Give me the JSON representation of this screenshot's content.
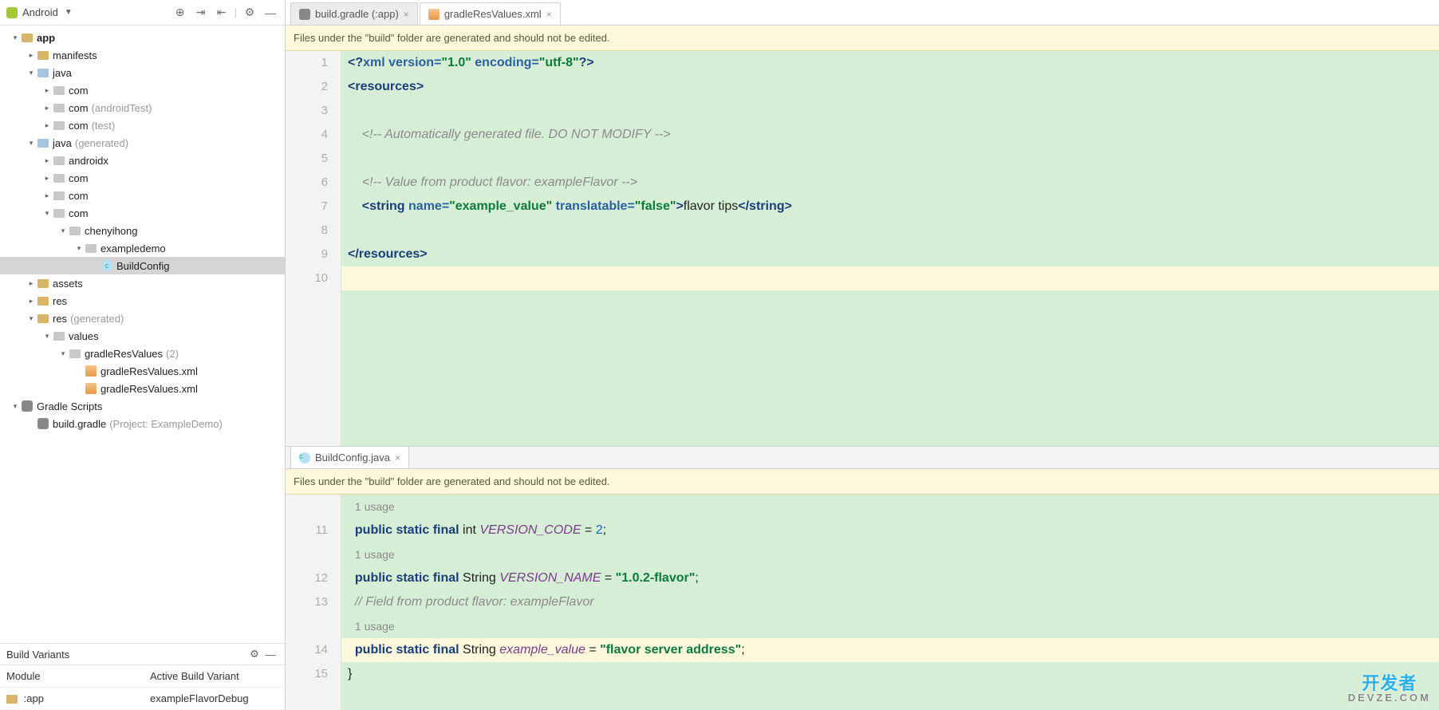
{
  "sidebar": {
    "projectSelector": "Android",
    "tree": [
      {
        "d": 0,
        "ex": "v",
        "ic": "folder-closed",
        "lbl": "app",
        "bold": true
      },
      {
        "d": 1,
        "ex": ">",
        "ic": "folder-closed",
        "lbl": "manifests"
      },
      {
        "d": 1,
        "ex": "v",
        "ic": "folder-java",
        "lbl": "java"
      },
      {
        "d": 2,
        "ex": ">",
        "ic": "folder-gray",
        "lbl": "com"
      },
      {
        "d": 2,
        "ex": ">",
        "ic": "folder-gray",
        "lbl": "com",
        "suf": "(androidTest)"
      },
      {
        "d": 2,
        "ex": ">",
        "ic": "folder-gray",
        "lbl": "com",
        "suf": "(test)"
      },
      {
        "d": 1,
        "ex": "v",
        "ic": "folder-java",
        "lbl": "java",
        "suf": "(generated)"
      },
      {
        "d": 2,
        "ex": ">",
        "ic": "folder-gray",
        "lbl": "androidx"
      },
      {
        "d": 2,
        "ex": ">",
        "ic": "folder-gray",
        "lbl": "com"
      },
      {
        "d": 2,
        "ex": ">",
        "ic": "folder-gray",
        "lbl": "com"
      },
      {
        "d": 2,
        "ex": "v",
        "ic": "folder-gray",
        "lbl": "com"
      },
      {
        "d": 3,
        "ex": "v",
        "ic": "folder-gray",
        "lbl": "chenyihong"
      },
      {
        "d": 4,
        "ex": "v",
        "ic": "folder-gray",
        "lbl": "exampledemo"
      },
      {
        "d": 5,
        "ex": "",
        "ic": "file-c",
        "lbl": "BuildConfig",
        "sel": true
      },
      {
        "d": 1,
        "ex": ">",
        "ic": "folder-closed",
        "lbl": "assets"
      },
      {
        "d": 1,
        "ex": ">",
        "ic": "folder-closed",
        "lbl": "res"
      },
      {
        "d": 1,
        "ex": "v",
        "ic": "folder-closed",
        "lbl": "res",
        "suf": "(generated)"
      },
      {
        "d": 2,
        "ex": "v",
        "ic": "folder-gray",
        "lbl": "values"
      },
      {
        "d": 3,
        "ex": "v",
        "ic": "folder-gray",
        "lbl": "gradleResValues",
        "suf": "(2)"
      },
      {
        "d": 4,
        "ex": "",
        "ic": "file-xml",
        "lbl": "gradleResValues.xml"
      },
      {
        "d": 4,
        "ex": "",
        "ic": "file-xml",
        "lbl": "gradleResValues.xml"
      },
      {
        "d": 0,
        "ex": "v",
        "ic": "gradle-ic",
        "lbl": "Gradle Scripts"
      },
      {
        "d": 1,
        "ex": "",
        "ic": "gradle-ic",
        "lbl": "build.gradle",
        "suf": "(Project: ExampleDemo)"
      }
    ]
  },
  "buildVariants": {
    "title": "Build Variants",
    "headers": {
      "module": "Module",
      "variant": "Active Build Variant"
    },
    "rows": [
      {
        "module": ":app",
        "variant": "exampleFlavorDebug"
      }
    ]
  },
  "topTabs": [
    {
      "icon": "gradle-ic",
      "label": "build.gradle (:app)",
      "active": false
    },
    {
      "icon": "file-xml",
      "label": "gradleResValues.xml",
      "active": true
    }
  ],
  "banner1": "Files under the \"build\" folder are generated and should not be edited.",
  "editor1": {
    "gutter": [
      "1",
      "2",
      "3",
      "4",
      "5",
      "6",
      "7",
      "8",
      "9",
      "10"
    ],
    "lines": [
      {
        "t": "pi",
        "text": "<?xml version=\"1.0\" encoding=\"utf-8\"?>"
      },
      {
        "t": "open",
        "tag": "resources"
      },
      {
        "t": "blank"
      },
      {
        "t": "cmt",
        "text": "    <!-- Automatically generated file. DO NOT MODIFY -->"
      },
      {
        "t": "blank"
      },
      {
        "t": "cmt",
        "text": "    <!-- Value from product flavor: exampleFlavor -->"
      },
      {
        "t": "string",
        "attrs": "name=\"example_value\" translatable=\"false\"",
        "content": "flavor tips"
      },
      {
        "t": "blank"
      },
      {
        "t": "close",
        "tag": "resources"
      },
      {
        "t": "blank",
        "hl": true
      }
    ]
  },
  "bottomTabs": [
    {
      "icon": "file-c",
      "label": "BuildConfig.java",
      "active": true
    }
  ],
  "banner2": "Files under the \"build\" folder are generated and should not be edited.",
  "editor2": {
    "gutter": [
      "",
      "11",
      "",
      "12",
      "13",
      "",
      "14",
      "15"
    ],
    "lines": [
      {
        "t": "usage",
        "text": "1 usage"
      },
      {
        "t": "j",
        "kw": "public static final",
        "ty": "int",
        "fld": "VERSION_CODE",
        "rest": " = ",
        "lit": "2",
        "end": ";"
      },
      {
        "t": "usage",
        "text": "1 usage"
      },
      {
        "t": "j",
        "kw": "public static final",
        "ty": "String",
        "fld": "VERSION_NAME",
        "rest": " = ",
        "str": "\"1.0.2-flavor\"",
        "end": ";"
      },
      {
        "t": "jcmt",
        "text": "// Field from product flavor: exampleFlavor"
      },
      {
        "t": "usage",
        "text": "1 usage"
      },
      {
        "t": "j",
        "kw": "public static final",
        "ty": "String",
        "fld": "example_value",
        "rest": " = ",
        "str": "\"flavor server address\"",
        "end": ";",
        "hl": true
      },
      {
        "t": "brace",
        "text": "}"
      }
    ]
  },
  "watermark": {
    "line1": "开发者",
    "line2": "DEVZE.COM"
  }
}
